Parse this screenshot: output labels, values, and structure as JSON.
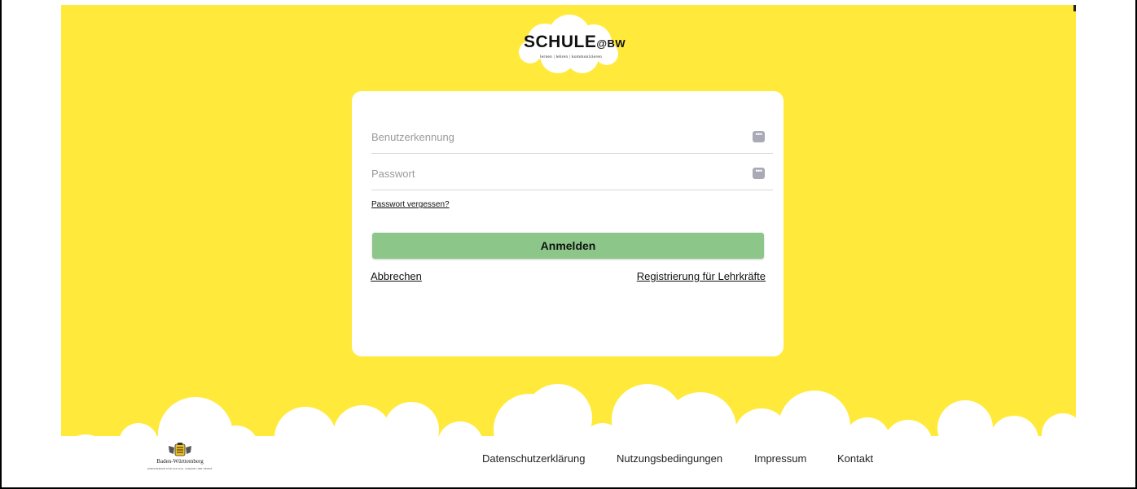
{
  "brand": {
    "logo_main": "SCHULE",
    "logo_suffix": "@BW",
    "logo_tagline": "lernen | lehren | kommunizieren"
  },
  "login": {
    "username_placeholder": "Benutzerkennung",
    "username_value": "",
    "password_placeholder": "Passwort",
    "password_value": "",
    "forgot_label": "Passwort vergessen?",
    "submit_label": "Anmelden",
    "cancel_label": "Abbrechen",
    "register_label": "Registrierung für Lehrkräfte"
  },
  "footer": {
    "bw_name": "Baden-Württemberg",
    "bw_subtitle": "MINISTERIUM FÜR KULTUS, JUGEND UND SPORT",
    "links": {
      "privacy": "Datenschutzerklärung",
      "terms": "Nutzungsbedingungen",
      "imprint": "Impressum",
      "contact": "Kontakt"
    }
  },
  "icons": {
    "field_icon": "password-manager-key-icon",
    "logo_cloud": "cloud-icon",
    "bw_crest": "coat-of-arms-icon"
  },
  "colors": {
    "background": "#ffea3b",
    "button": "#8dc689",
    "card": "#ffffff"
  }
}
